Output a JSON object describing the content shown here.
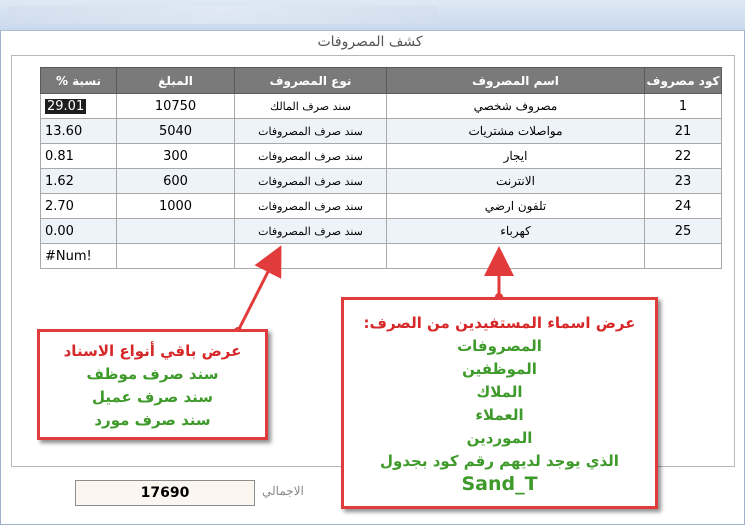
{
  "window": {
    "title": "كشف المصروفات"
  },
  "grid": {
    "columns": [
      "كود مصروف",
      "اسم المصروف",
      "نوع المصروف",
      "المبلغ",
      "نسبة %"
    ],
    "rows": [
      {
        "code": "1",
        "name": "مصروف شخصي",
        "type": "سند صرف المالك",
        "amount": "10750",
        "pct": "29.01"
      },
      {
        "code": "21",
        "name": "مواصلات مشتريات",
        "type": "سند صرف المصروفات",
        "amount": "5040",
        "pct": "13.60"
      },
      {
        "code": "22",
        "name": "ايجار",
        "type": "سند صرف المصروفات",
        "amount": "300",
        "pct": "0.81"
      },
      {
        "code": "23",
        "name": "الانترنت",
        "type": "سند صرف المصروفات",
        "amount": "600",
        "pct": "1.62"
      },
      {
        "code": "24",
        "name": "تلفون ارضي",
        "type": "سند صرف المصروفات",
        "amount": "1000",
        "pct": "2.70"
      },
      {
        "code": "25",
        "name": "كهرباء",
        "type": "سند صرف المصروفات",
        "amount": "",
        "pct": "0.00"
      },
      {
        "code": "",
        "name": "",
        "type": "",
        "amount": "",
        "pct": "#Num!"
      }
    ]
  },
  "total": {
    "label": "الاجمالي",
    "value": "17690"
  },
  "annotations": {
    "left": [
      "عرض باقي أنواع الاسناد",
      "سند صرف موظف",
      "سند صرف عميل",
      "سند صرف مورد"
    ],
    "right": [
      "عرض اسماء المستفيدين من الصرف:",
      "المصروفات",
      "الموظفين",
      "الملاك",
      "العملاء",
      "الموردين",
      "الذي يوجد لديهم رقم كود بجدول",
      "Sand_T"
    ]
  },
  "colors": {
    "header_bg": "#7a7a7a",
    "alt_row": "#eef3fa",
    "annotation_border": "#e23b3b",
    "annotation_green": "#3e9a2a",
    "annotation_red": "#d62828"
  }
}
